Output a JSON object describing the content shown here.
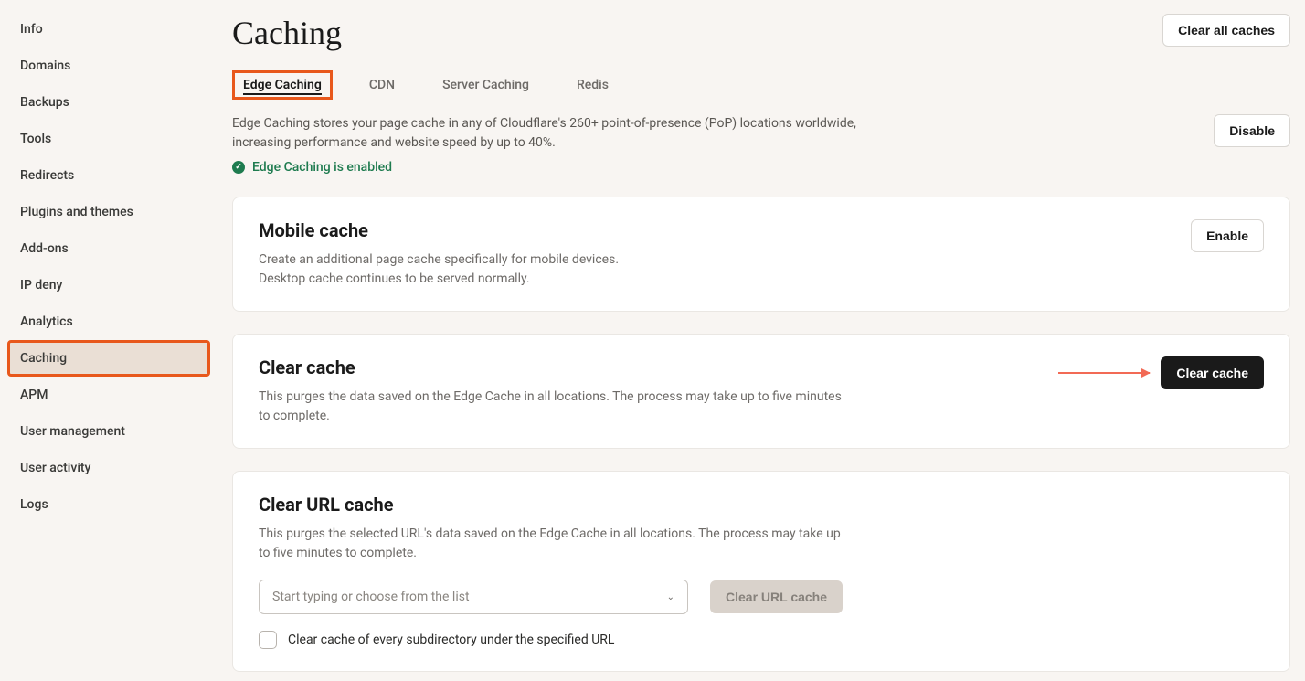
{
  "sidebar": {
    "items": [
      {
        "label": "Info",
        "active": false
      },
      {
        "label": "Domains",
        "active": false
      },
      {
        "label": "Backups",
        "active": false
      },
      {
        "label": "Tools",
        "active": false
      },
      {
        "label": "Redirects",
        "active": false
      },
      {
        "label": "Plugins and themes",
        "active": false
      },
      {
        "label": "Add-ons",
        "active": false
      },
      {
        "label": "IP deny",
        "active": false
      },
      {
        "label": "Analytics",
        "active": false
      },
      {
        "label": "Caching",
        "active": true
      },
      {
        "label": "APM",
        "active": false
      },
      {
        "label": "User management",
        "active": false
      },
      {
        "label": "User activity",
        "active": false
      },
      {
        "label": "Logs",
        "active": false
      }
    ]
  },
  "page": {
    "title": "Caching",
    "clear_all_label": "Clear all caches"
  },
  "tabs": [
    {
      "label": "Edge Caching",
      "active": true
    },
    {
      "label": "CDN",
      "active": false
    },
    {
      "label": "Server Caching",
      "active": false
    },
    {
      "label": "Redis",
      "active": false
    }
  ],
  "intro": {
    "text": "Edge Caching stores your page cache in any of Cloudflare's 260+ point-of-presence (PoP) locations worldwide, increasing performance and website speed by up to 40%.",
    "disable_label": "Disable",
    "status": "Edge Caching is enabled"
  },
  "mobile_cache": {
    "title": "Mobile cache",
    "desc1": "Create an additional page cache specifically for mobile devices.",
    "desc2": "Desktop cache continues to be served normally.",
    "enable_label": "Enable"
  },
  "clear_cache": {
    "title": "Clear cache",
    "desc": "This purges the data saved on the Edge Cache in all locations. The process may take up to five minutes to complete.",
    "button_label": "Clear cache"
  },
  "clear_url": {
    "title": "Clear URL cache",
    "desc": "This purges the selected URL's data saved on the Edge Cache in all locations. The process may take up to five minutes to complete.",
    "placeholder": "Start typing or choose from the list",
    "button_label": "Clear URL cache",
    "checkbox_label": "Clear cache of every subdirectory under the specified URL"
  }
}
